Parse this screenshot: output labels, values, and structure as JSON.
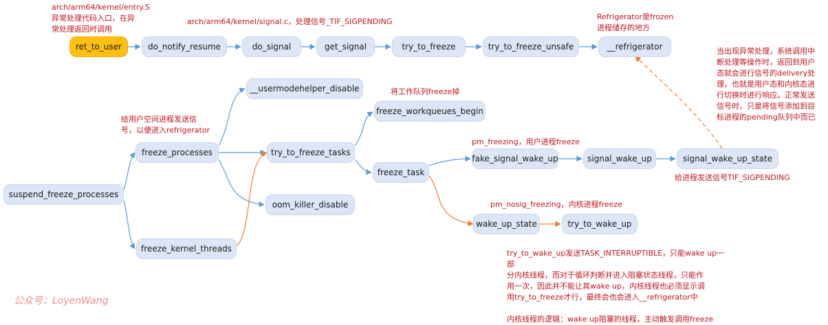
{
  "nodes": {
    "ret_to_user": "ret_to_user",
    "do_notify_resume": "do_notify_resume",
    "do_signal": "do_signal",
    "get_signal": "get_signal",
    "try_to_freeze": "try_to_freeze",
    "try_to_freeze_unsafe": "try_to_freeze_unsafe",
    "refrigerator": "__refrigerator",
    "usermodehelper_disable": "__usermodehelper_disable",
    "freeze_processes": "freeze_processes",
    "suspend_freeze_processes": "suspend_freeze_processes",
    "try_to_freeze_tasks": "try_to_freeze_tasks",
    "freeze_workqueues_begin": "freeze_workqueues_begin",
    "freeze_task": "freeze_task",
    "oom_killer_disable": "oom_killer_disable",
    "freeze_kernel_threads": "freeze_kernel_threads",
    "fake_signal_wake_up": "fake_signal_wake_up",
    "signal_wake_up": "signal_wake_up",
    "signal_wake_up_state": "signal_wake_up_state",
    "wake_up_state": "wake_up_state",
    "try_to_wake_up": "try_to_wake_up"
  },
  "notes": {
    "entry_s": "arch/arm64/kernel/entry.S\n异常处理代码入口，在异\n常处理返回时调用",
    "signal_c": "arch/arm64/kernel/signal.c，处理信号_TIF_SIGPENDING",
    "refrigerator": "Refrigerator是frozen\n进程储存的地方",
    "delivery": "当出现异常处理，系统调用中\n断处理等操作时，返回到用户\n态就会进行信号的delivery处\n理，也就是用户态和内核态进\n行切换时进行响应。正常发送\n信号时，只是将信号添加到目\n标进程的pending队列中而已",
    "workqueue": "将工作队列freeze掉",
    "user_signal": "给用户空间进程发送信\n号，以便进入refrigerator",
    "pm_freezing": "pm_freezing，用户进程freeze",
    "tif_sigpending": "给进程发送信号TIF_SIGPENDING",
    "pm_nosig": "pm_nosig_freezing，内核进程freeze",
    "kernel_thread": "try_to_wake_up发送TASK_INTERRUPTIBLE，只能wake up一部\n分内核线程，而对于循环判断并进入阻塞状态线程，只能作\n用一次，因此并不能让其wake up，内核线程也必须显示调\n用try_to_freeze才行，最终会也会进入__refrigerator中\n\n内核线程的逻辑：wake up阻塞的线程，主动触发调用freeze"
  },
  "watermark": "公众号：LoyenWang",
  "colors": {
    "blue_edge": "#5b9bd5",
    "orange_edge": "#ed7d31",
    "node_fill": "#dde6f6",
    "entry_fill": "#fdbf12",
    "note_text": "#c0141c"
  }
}
